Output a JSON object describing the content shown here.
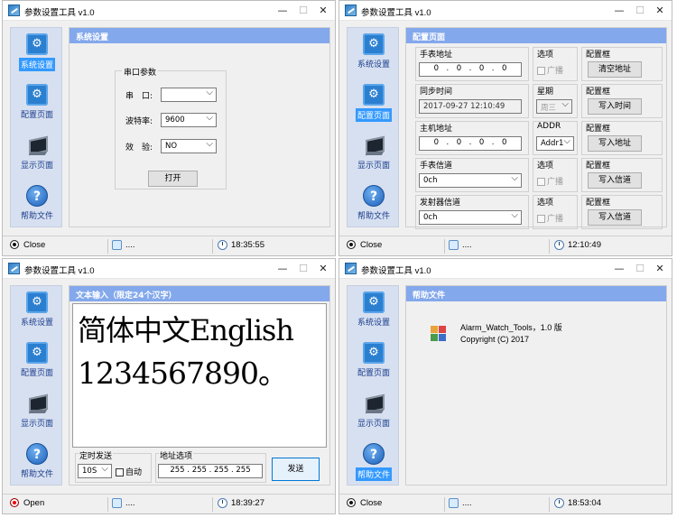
{
  "app_title": "参数设置工具 v1.0",
  "nav": {
    "settings": "系统设置",
    "config": "配置页面",
    "display": "显示页面",
    "help": "帮助文件"
  },
  "win1": {
    "panel_title": "系统设置",
    "group_label": "串口参数",
    "port_label": "串　口:",
    "port_value": "",
    "baud_label": "波特率:",
    "baud_value": "9600",
    "parity_label": "效　验:",
    "parity_value": "NO",
    "open_button": "打开",
    "status": {
      "state": "Close",
      "user": "....",
      "time": "18:35:55"
    }
  },
  "win2": {
    "panel_title": "配置页面",
    "rows": [
      {
        "label": "手表地址",
        "ip": [
          "0",
          "0",
          "0",
          "0"
        ],
        "opt_label": "选项",
        "opt": "广播",
        "cfg_label": "配置框",
        "btn": "清空地址"
      },
      {
        "label": "同步时间",
        "value": "2017-09-27 12:10:49",
        "opt_label": "星期",
        "opt": "周三",
        "cfg_label": "配置框",
        "btn": "写入时间"
      },
      {
        "label": "主机地址",
        "ip": [
          "0",
          "0",
          "0",
          "0"
        ],
        "opt_label": "ADDR",
        "opt": "Addr1",
        "cfg_label": "配置框",
        "btn": "写入地址"
      },
      {
        "label": "手表信道",
        "value": "0ch",
        "opt_label": "选项",
        "opt": "广播",
        "cfg_label": "配置框",
        "btn": "写入信道"
      },
      {
        "label": "发射器信道",
        "value": "0ch",
        "opt_label": "选项",
        "opt": "广播",
        "cfg_label": "配置框",
        "btn": "写入信道"
      }
    ],
    "status": {
      "state": "Close",
      "user": "....",
      "time": "12:10:49"
    }
  },
  "win3": {
    "panel_title": "文本输入（限定24个汉字）",
    "text_line1": "简体中文English",
    "text_line2": "1234567890。",
    "timer_label": "定时发送",
    "timer_value": "10S",
    "auto_label": "自动",
    "addr_label": "地址选项",
    "addr": [
      "255",
      "255",
      "255",
      "255"
    ],
    "send_button": "发送",
    "status": {
      "state": "Open",
      "user": "....",
      "time": "18:39:27"
    }
  },
  "win4": {
    "panel_title": "帮助文件",
    "app_name": "Alarm_Watch_Tools，1.0 版",
    "copyright": "Copyright (C) 2017",
    "status": {
      "state": "Close",
      "user": "....",
      "time": "18:53:04"
    }
  }
}
